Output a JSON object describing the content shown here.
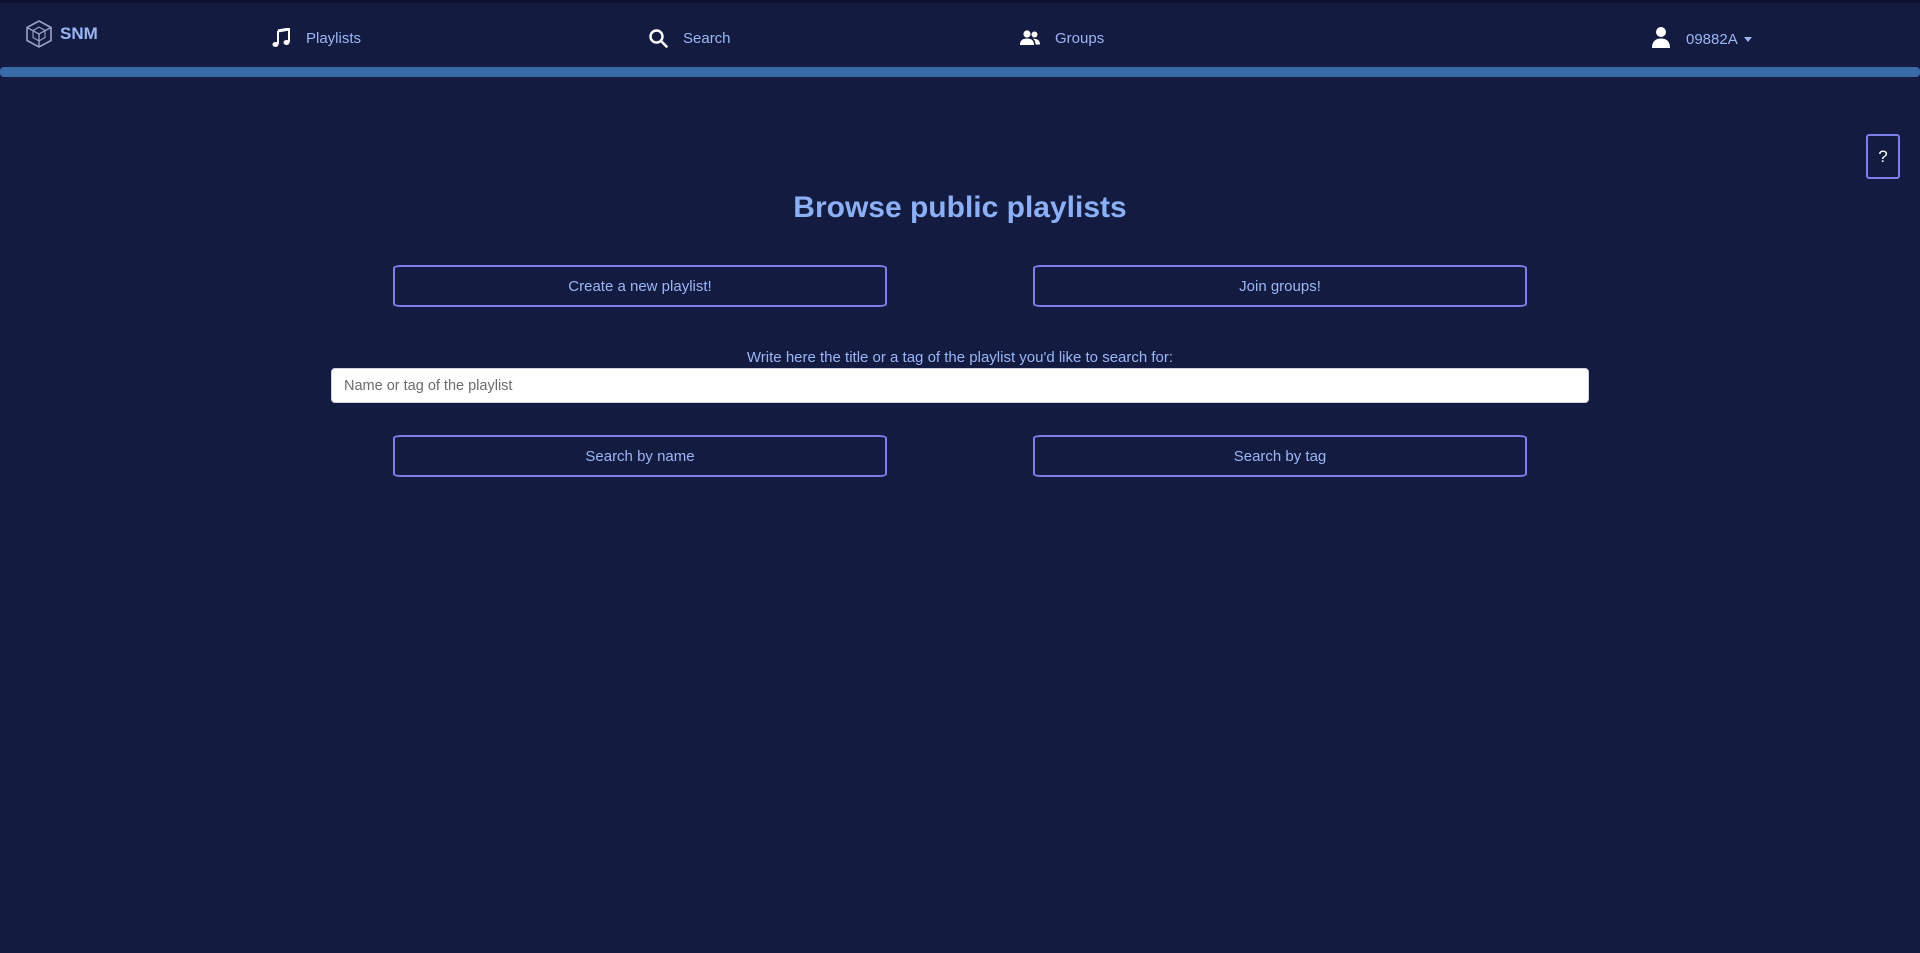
{
  "brand": {
    "name": "SNM",
    "icon": "cube-logo-icon"
  },
  "nav": {
    "playlists": {
      "label": "Playlists",
      "icon": "music-note-icon"
    },
    "search": {
      "label": "Search",
      "icon": "search-icon"
    },
    "groups": {
      "label": "Groups",
      "icon": "users-icon"
    },
    "user": {
      "label": "09882A",
      "icon": "user-icon"
    }
  },
  "help": {
    "label": "?"
  },
  "main": {
    "title": "Browse public playlists",
    "create_button": "Create a new playlist!",
    "join_button": "Join groups!",
    "search_label": "Write here the title or a tag of the playlist you'd like to search for:",
    "search_placeholder": "Name or tag of the playlist",
    "search_value": "",
    "search_by_name_button": "Search by name",
    "search_by_tag_button": "Search by tag"
  },
  "colors": {
    "background": "#141b41",
    "accent_bar": "#3b6aa8",
    "text": "#9bb6f5",
    "button_border": "#7c7fe8"
  }
}
